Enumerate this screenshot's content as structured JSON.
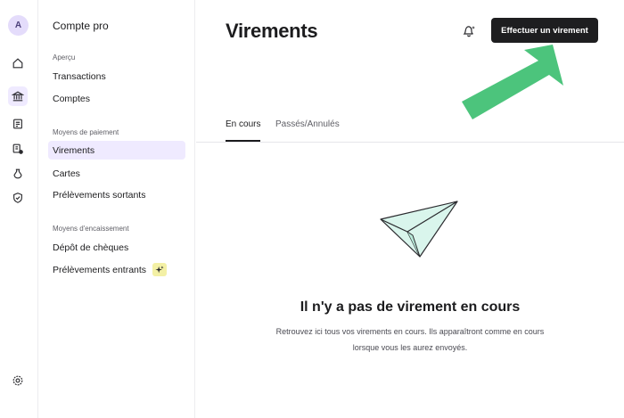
{
  "rail": {
    "avatar_initial": "A",
    "icons": [
      "home-icon",
      "bank-icon",
      "invoice-icon",
      "documents-icon",
      "pot-icon",
      "shield-icon",
      "settings-icon"
    ]
  },
  "sidebar": {
    "title": "Compte pro",
    "sections": [
      {
        "label": "Aperçu",
        "items": [
          "Transactions",
          "Comptes"
        ]
      },
      {
        "label": "Moyens de paiement",
        "items": [
          "Virements",
          "Cartes",
          "Prélèvements sortants"
        ]
      },
      {
        "label": "Moyens d'encaissement",
        "items": [
          "Dépôt de chèques",
          "Prélèvements entrants"
        ]
      }
    ],
    "active_item": "Virements"
  },
  "header": {
    "title": "Virements",
    "cta_label": "Effectuer un virement"
  },
  "tabs": [
    {
      "label": "En cours",
      "active": true
    },
    {
      "label": "Passés/Annulés",
      "active": false
    }
  ],
  "empty_state": {
    "title": "Il n'y a pas de virement en cours",
    "line1": "Retrouvez ici tous vos virements en cours. Ils apparaîtront comme en cours",
    "line2": "lorsque vous les aurez envoyés."
  },
  "colors": {
    "accent_bg": "#efeaff",
    "cta_bg": "#1e1e20",
    "arrow_green": "#4cc47c",
    "plane_fill": "#d9f5ec"
  }
}
